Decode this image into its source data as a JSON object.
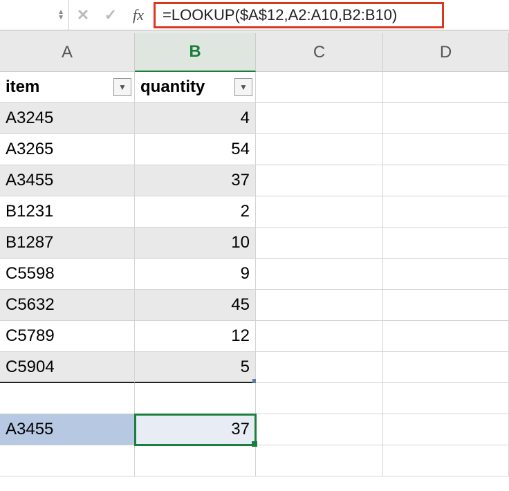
{
  "formula_bar": {
    "fx_label": "fx",
    "formula": "=LOOKUP($A$12,A2:A10,B2:B10)"
  },
  "columns": {
    "A": "A",
    "B": "B",
    "C": "C",
    "D": "D"
  },
  "headers": {
    "item": "item",
    "quantity": "quantity"
  },
  "rows": [
    {
      "item": "A3245",
      "quantity": "4"
    },
    {
      "item": "A3265",
      "quantity": "54"
    },
    {
      "item": "A3455",
      "quantity": "37"
    },
    {
      "item": "B1231",
      "quantity": "2"
    },
    {
      "item": "B1287",
      "quantity": "10"
    },
    {
      "item": "C5598",
      "quantity": "9"
    },
    {
      "item": "C5632",
      "quantity": "45"
    },
    {
      "item": "C5789",
      "quantity": "12"
    },
    {
      "item": "C5904",
      "quantity": "5"
    }
  ],
  "lookup": {
    "key": "A3455",
    "result": "37"
  },
  "chart_data": {
    "type": "table",
    "columns": [
      "item",
      "quantity"
    ],
    "rows": [
      [
        "A3245",
        4
      ],
      [
        "A3265",
        54
      ],
      [
        "A3455",
        37
      ],
      [
        "B1231",
        2
      ],
      [
        "B1287",
        10
      ],
      [
        "C5598",
        9
      ],
      [
        "C5632",
        45
      ],
      [
        "C5789",
        12
      ],
      [
        "C5904",
        5
      ]
    ],
    "lookup_key": "A3455",
    "lookup_result": 37,
    "formula": "=LOOKUP($A$12,A2:A10,B2:B10)"
  }
}
